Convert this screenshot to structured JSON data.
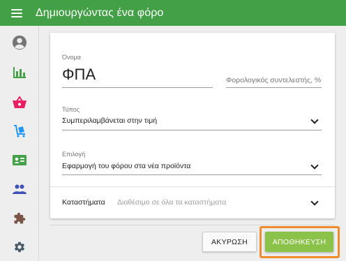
{
  "appbar": {
    "title": "Δημιουργώντας ένα φόρο"
  },
  "sidebar": {
    "items": [
      {
        "icon": "account-circle-icon"
      },
      {
        "icon": "bar-chart-icon",
        "color": "#43a047"
      },
      {
        "icon": "shopping-basket-icon",
        "color": "#e91e63"
      },
      {
        "icon": "luggage-cart-icon",
        "color": "#2196f3"
      },
      {
        "icon": "contact-card-icon",
        "color": "#43a047"
      },
      {
        "icon": "people-icon",
        "color": "#3f51b5"
      },
      {
        "icon": "puzzle-icon",
        "color": "#795548"
      },
      {
        "icon": "gear-icon",
        "color": "#455a64"
      }
    ]
  },
  "form": {
    "name": {
      "label": "Όνομα",
      "value": "ΦΠΑ"
    },
    "tax_rate": {
      "placeholder": "Φορολογικός συντελεστής, %"
    },
    "type": {
      "label": "Τύπος",
      "value": "Συμπεριλαμβάνεται στην τιμή"
    },
    "option": {
      "label": "Επιλογή",
      "value": "Εφαρμογή του φόρου στα νέα προϊόντα"
    },
    "stores": {
      "label": "Καταστήματα",
      "value": "Διαθέσιμο σε όλα τα καταστήματα"
    }
  },
  "actions": {
    "cancel_label": "ΑΚΥΡΩΣΗ",
    "save_label": "ΑΠΟΘΗΚΕΥΣΗ"
  },
  "colors": {
    "primary": "#43a047",
    "accent": "#8bc34a",
    "highlight": "#f08a2c"
  }
}
